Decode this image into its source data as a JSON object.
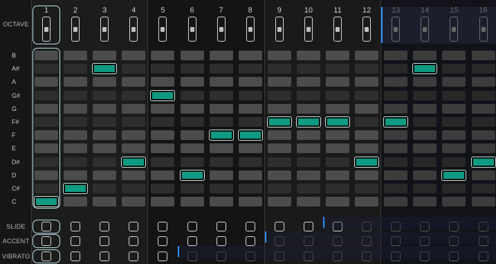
{
  "app": {
    "accent": "#0f9a82",
    "marker": "#2f8fff"
  },
  "labels": {
    "octave": "OCTAVE",
    "slide": "SLIDE",
    "accent": "ACCENT",
    "vibrato": "VIBRATO"
  },
  "notes": [
    "B",
    "A#",
    "A",
    "G#",
    "G",
    "F#",
    "F",
    "E",
    "D#",
    "D",
    "C#",
    "C"
  ],
  "steps": [
    {
      "num": "1",
      "note": "C",
      "dim": false
    },
    {
      "num": "2",
      "note": "C#",
      "dim": false
    },
    {
      "num": "3",
      "note": "A#",
      "dim": false
    },
    {
      "num": "4",
      "note": "D#",
      "dim": false
    },
    {
      "num": "5",
      "note": "G#",
      "dim": false
    },
    {
      "num": "6",
      "note": "D",
      "dim": false
    },
    {
      "num": "7",
      "note": "F",
      "dim": false
    },
    {
      "num": "8",
      "note": "F",
      "dim": false
    },
    {
      "num": "9",
      "note": "F#",
      "dim": false
    },
    {
      "num": "10",
      "note": "F#",
      "dim": false
    },
    {
      "num": "11",
      "note": "F#",
      "dim": false
    },
    {
      "num": "12",
      "note": "D#",
      "dim": false
    },
    {
      "num": "13",
      "note": "F#",
      "dim": true
    },
    {
      "num": "14",
      "note": "A#",
      "dim": true
    },
    {
      "num": "15",
      "note": "D",
      "dim": true
    },
    {
      "num": "16",
      "note": "D#",
      "dim": true
    }
  ],
  "selected_step": "1"
}
